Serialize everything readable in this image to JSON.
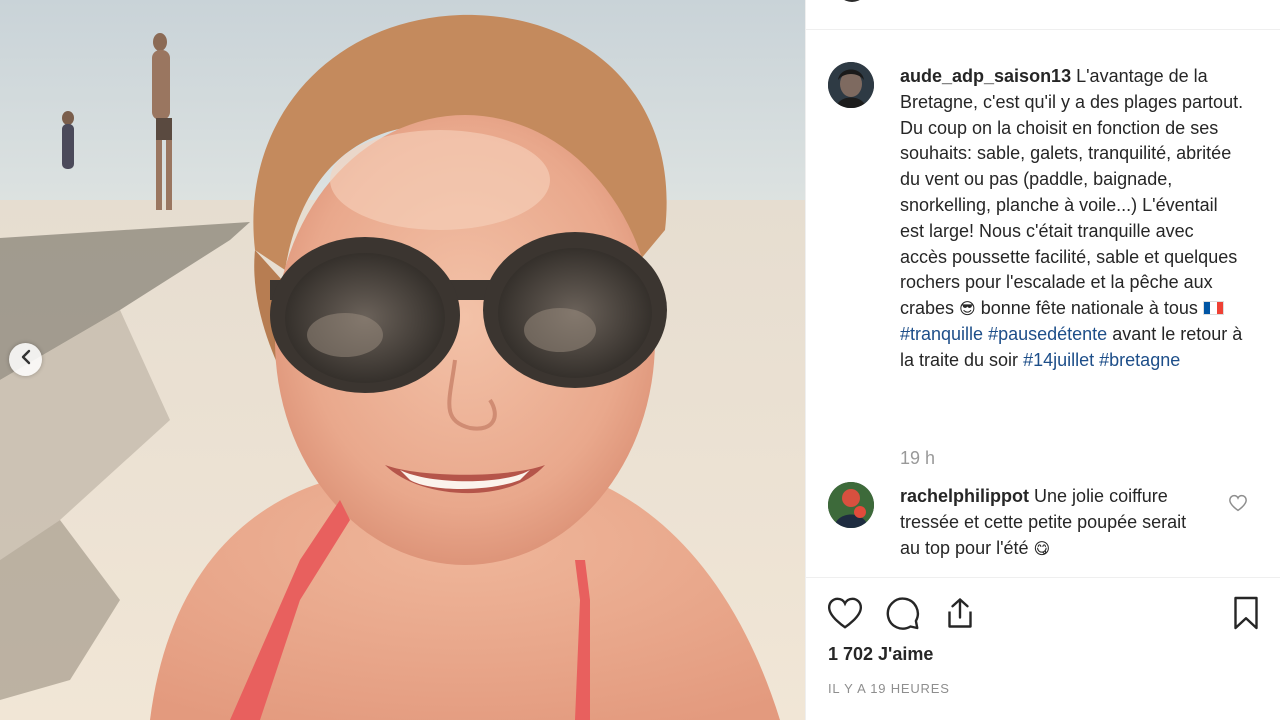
{
  "post": {
    "author": "aude_adp_saison13",
    "caption_parts": {
      "p1": "L'avantage de la Bretagne, c'est qu'il y a des plages partout. Du coup on la choisit en fonction de ses souhaits: sable, galets, tranquilité, abritée du vent ou pas (paddle, baignade, snorkelling, planche à voile...) L'éventail est large! Nous c'était tranquille avec accès poussette facilité, sable et quelques rochers pour l'escalade et la pêche aux crabes",
      "emoji_sunglasses": "😎",
      "p2": "bonne fête nationale à tous",
      "tag1": "#tranquille",
      "tag2": "#pausedétente",
      "p3": "avant le retour à la traite du soir",
      "tag3": "#14juillet",
      "tag4": "#bretagne"
    },
    "time_ago": "19 h",
    "likes": "1 702 J'aime",
    "posted": "IL Y A 19 HEURES",
    "flag_colors": [
      "#0055A4",
      "#FFFFFF",
      "#EF4135"
    ]
  },
  "comments": [
    {
      "author": "rachelphilippot",
      "text": "Une jolie coiffure tressée et cette petite poupée serait au top pour l'été",
      "emoji": "😋"
    }
  ],
  "icons": {
    "prev": "chevron-left-icon",
    "like": "heart-icon",
    "comment": "comment-icon",
    "share": "share-icon",
    "save": "bookmark-icon",
    "comment_like": "heart-icon"
  }
}
